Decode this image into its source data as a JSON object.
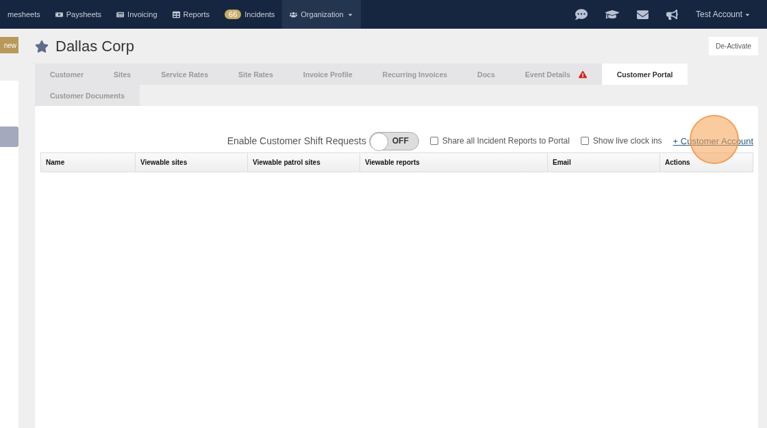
{
  "navbar": {
    "items": [
      {
        "label": "mesheets",
        "selected": false
      },
      {
        "label": "Paysheets",
        "selected": false
      },
      {
        "label": "Invoicing",
        "selected": false
      },
      {
        "label": "Reports",
        "selected": false
      },
      {
        "label": "Incidents",
        "badge": "66",
        "selected": false
      },
      {
        "label": "Organization",
        "selected": true
      }
    ],
    "account": "Test Account"
  },
  "sidebar": {
    "new_button": "new"
  },
  "header": {
    "title": "Dallas Corp",
    "deactivate_button": "De-Activate"
  },
  "tabs": [
    {
      "label": "Customer",
      "selected": false,
      "warning": false
    },
    {
      "label": "Sites",
      "selected": false,
      "warning": false
    },
    {
      "label": "Service Rates",
      "selected": false,
      "warning": false
    },
    {
      "label": "Site Rates",
      "selected": false,
      "warning": false
    },
    {
      "label": "Invoice Profile",
      "selected": false,
      "warning": false
    },
    {
      "label": "Recurring Invoices",
      "selected": false,
      "warning": false
    },
    {
      "label": "Docs",
      "selected": false,
      "warning": false
    },
    {
      "label": "Event Details",
      "selected": false,
      "warning": true
    },
    {
      "label": "Customer Portal",
      "selected": true,
      "warning": false
    },
    {
      "label": "Customer Documents",
      "selected": false,
      "warning": false
    }
  ],
  "portal": {
    "shift_requests": {
      "label": "Enable Customer Shift Requests",
      "on": false,
      "off_text": "OFF"
    },
    "checkboxes": [
      {
        "label": "Share all Incident Reports to Portal",
        "checked": false
      },
      {
        "label": "Show live clock ins",
        "checked": false
      }
    ],
    "add_link": "+ Customer Account",
    "table": {
      "columns": [
        "Name",
        "Viewable sites",
        "Viewable patrol sites",
        "Viewable reports",
        "Email",
        "Actions"
      ]
    }
  }
}
